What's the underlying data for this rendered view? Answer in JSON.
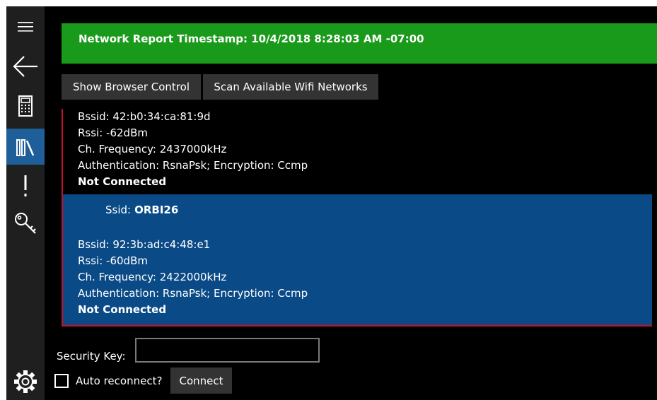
{
  "sidebar": {
    "items": [
      {
        "icon": "hamburger-menu-icon"
      },
      {
        "icon": "back-arrow-icon"
      },
      {
        "icon": "calculator-icon"
      },
      {
        "icon": "library-icon",
        "selected": true
      },
      {
        "icon": "exclamation-icon"
      },
      {
        "icon": "key-icon"
      },
      {
        "icon": "gear-icon"
      }
    ]
  },
  "banner": {
    "text": "Network Report Timestamp: 10/4/2018 8:28:03 AM -07:00",
    "color": "#1a9a1a"
  },
  "toolbar": {
    "show_browser_label": "Show Browser Control",
    "scan_wifi_label": "Scan Available Wifi Networks"
  },
  "networks": [
    {
      "bssid": "Bssid: 42:b0:34:ca:81:9d",
      "rssi": "Rssi: -62dBm",
      "frequency": "Ch. Frequency: 2437000kHz",
      "security": "Authentication: RsnaPsk; Encryption: Ccmp",
      "status": "Not Connected"
    },
    {
      "ssid_label": "Ssid:",
      "ssid": "ORBI26",
      "bssid": "Bssid: 92:3b:ad:c4:48:e1",
      "rssi": "Rssi: -60dBm",
      "frequency": "Ch. Frequency: 2422000kHz",
      "security": "Authentication: RsnaPsk; Encryption: Ccmp",
      "status": "Not Connected",
      "selected": true
    }
  ],
  "form": {
    "security_key_label": "Security Key:",
    "security_key_value": "",
    "auto_reconnect_label": "Auto reconnect?",
    "auto_reconnect_checked": false,
    "connect_label": "Connect"
  },
  "colors": {
    "sidebar_bg": "#1f1f1f",
    "selected_nav": "#1e5f9a",
    "selected_network": "#0a4a87",
    "border_accent": "#c8102e"
  }
}
